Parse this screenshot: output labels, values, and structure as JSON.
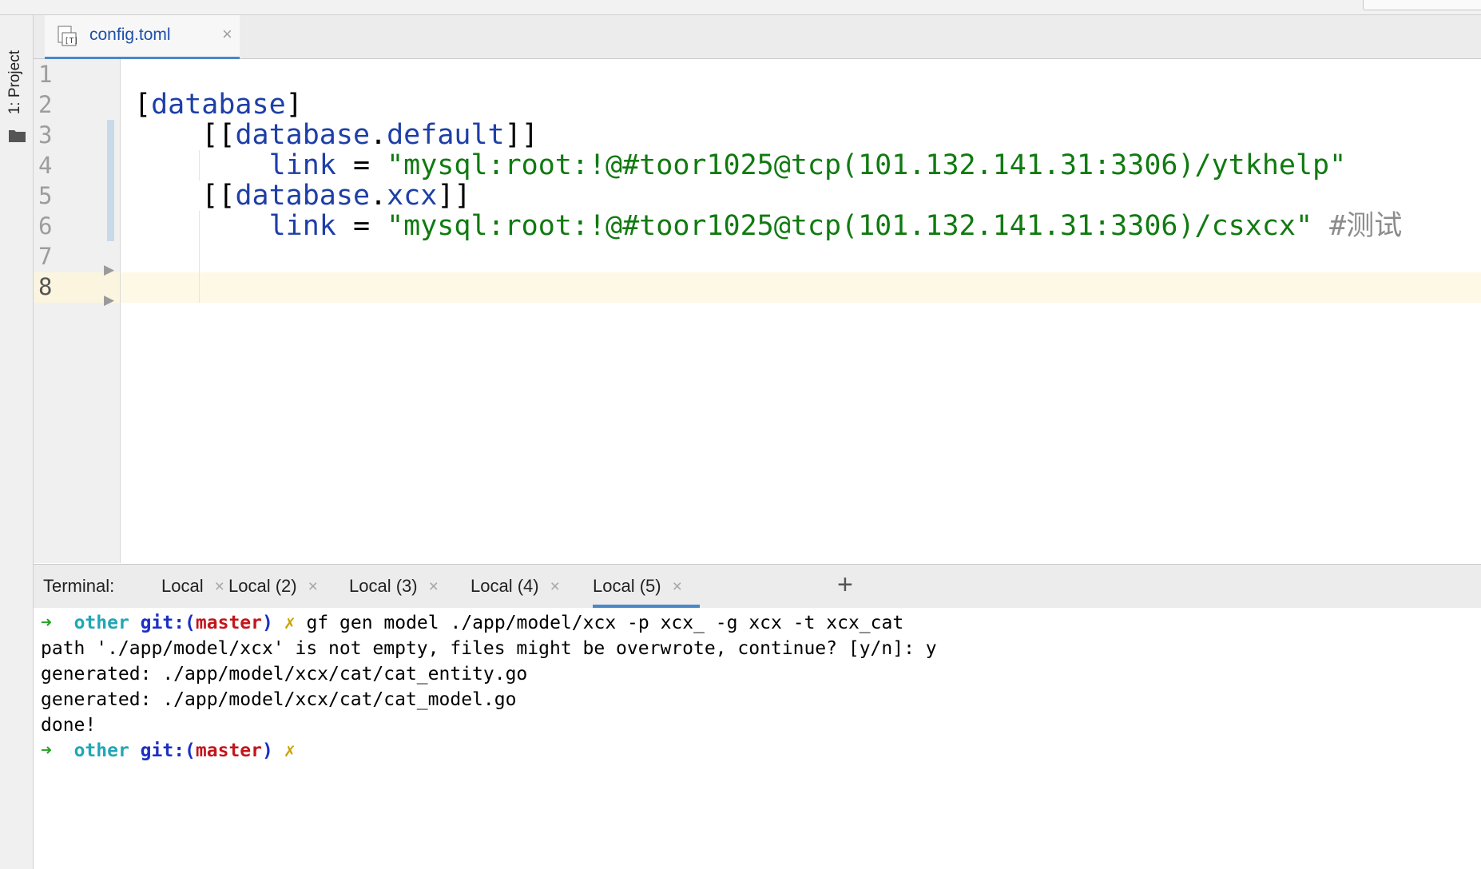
{
  "editor": {
    "tab": {
      "filename": "config.toml",
      "icon": "toml-file-icon",
      "close_glyph": "×"
    },
    "line_numbers": [
      "1",
      "2",
      "3",
      "4",
      "5",
      "6",
      "7",
      "8"
    ],
    "current_line": 8,
    "code": {
      "l2_table": "database",
      "l3_table": "database",
      "l3_sub": "default",
      "l4_key": "link",
      "l4_value": "\"mysql:root:!@#toor1025@tcp(101.132.141.31:3306)/ytkhelp\"",
      "l5_table": "database",
      "l5_sub": "xcx",
      "l6_key": "link",
      "l6_value": "\"mysql:root:!@#toor1025@tcp(101.132.141.31:3306)/csxcx\"",
      "l6_comment": "#测试"
    }
  },
  "sidebar": {
    "project_tab": "1: Project"
  },
  "terminal": {
    "title": "Terminal:",
    "tabs": [
      {
        "label": "Local"
      },
      {
        "label": "Local (2)"
      },
      {
        "label": "Local (3)"
      },
      {
        "label": "Local (4)"
      },
      {
        "label": "Local (5)",
        "active": true
      }
    ],
    "close_glyph": "×",
    "add_glyph": "+",
    "prompt": {
      "arrow": "➜",
      "dir": "other",
      "git_prefix": "git:(",
      "branch": "master",
      "git_suffix": ")",
      "dirty": "✗"
    },
    "command": "gf gen model ./app/model/xcx -p xcx_ -g xcx -t xcx_cat",
    "output": [
      "path './app/model/xcx' is not empty, files might be overwrote, continue? [y/n]: y",
      "generated: ./app/model/xcx/cat/cat_entity.go",
      "generated: ./app/model/xcx/cat/cat_model.go",
      "done!"
    ]
  },
  "colors": {
    "accent_tab_underline": "#4a88c7",
    "string": "#117a11",
    "keyword": "#1e3fa7",
    "prompt_arrow": "#26a326",
    "prompt_dir": "#22a6b6",
    "prompt_branch": "#c3161b"
  }
}
